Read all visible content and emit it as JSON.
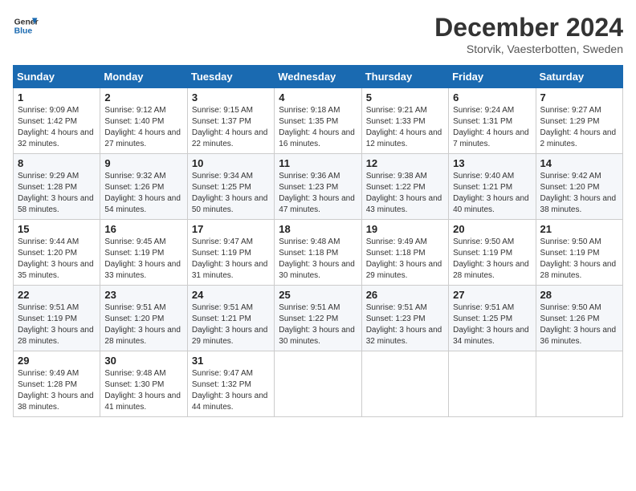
{
  "logo": {
    "line1": "General",
    "line2": "Blue"
  },
  "title": "December 2024",
  "subtitle": "Storvik, Vaesterbotten, Sweden",
  "header": {
    "days": [
      "Sunday",
      "Monday",
      "Tuesday",
      "Wednesday",
      "Thursday",
      "Friday",
      "Saturday"
    ]
  },
  "weeks": [
    [
      {
        "day": "1",
        "info": "Sunrise: 9:09 AM\nSunset: 1:42 PM\nDaylight: 4 hours and 32 minutes."
      },
      {
        "day": "2",
        "info": "Sunrise: 9:12 AM\nSunset: 1:40 PM\nDaylight: 4 hours and 27 minutes."
      },
      {
        "day": "3",
        "info": "Sunrise: 9:15 AM\nSunset: 1:37 PM\nDaylight: 4 hours and 22 minutes."
      },
      {
        "day": "4",
        "info": "Sunrise: 9:18 AM\nSunset: 1:35 PM\nDaylight: 4 hours and 16 minutes."
      },
      {
        "day": "5",
        "info": "Sunrise: 9:21 AM\nSunset: 1:33 PM\nDaylight: 4 hours and 12 minutes."
      },
      {
        "day": "6",
        "info": "Sunrise: 9:24 AM\nSunset: 1:31 PM\nDaylight: 4 hours and 7 minutes."
      },
      {
        "day": "7",
        "info": "Sunrise: 9:27 AM\nSunset: 1:29 PM\nDaylight: 4 hours and 2 minutes."
      }
    ],
    [
      {
        "day": "8",
        "info": "Sunrise: 9:29 AM\nSunset: 1:28 PM\nDaylight: 3 hours and 58 minutes."
      },
      {
        "day": "9",
        "info": "Sunrise: 9:32 AM\nSunset: 1:26 PM\nDaylight: 3 hours and 54 minutes."
      },
      {
        "day": "10",
        "info": "Sunrise: 9:34 AM\nSunset: 1:25 PM\nDaylight: 3 hours and 50 minutes."
      },
      {
        "day": "11",
        "info": "Sunrise: 9:36 AM\nSunset: 1:23 PM\nDaylight: 3 hours and 47 minutes."
      },
      {
        "day": "12",
        "info": "Sunrise: 9:38 AM\nSunset: 1:22 PM\nDaylight: 3 hours and 43 minutes."
      },
      {
        "day": "13",
        "info": "Sunrise: 9:40 AM\nSunset: 1:21 PM\nDaylight: 3 hours and 40 minutes."
      },
      {
        "day": "14",
        "info": "Sunrise: 9:42 AM\nSunset: 1:20 PM\nDaylight: 3 hours and 38 minutes."
      }
    ],
    [
      {
        "day": "15",
        "info": "Sunrise: 9:44 AM\nSunset: 1:20 PM\nDaylight: 3 hours and 35 minutes."
      },
      {
        "day": "16",
        "info": "Sunrise: 9:45 AM\nSunset: 1:19 PM\nDaylight: 3 hours and 33 minutes."
      },
      {
        "day": "17",
        "info": "Sunrise: 9:47 AM\nSunset: 1:19 PM\nDaylight: 3 hours and 31 minutes."
      },
      {
        "day": "18",
        "info": "Sunrise: 9:48 AM\nSunset: 1:18 PM\nDaylight: 3 hours and 30 minutes."
      },
      {
        "day": "19",
        "info": "Sunrise: 9:49 AM\nSunset: 1:18 PM\nDaylight: 3 hours and 29 minutes."
      },
      {
        "day": "20",
        "info": "Sunrise: 9:50 AM\nSunset: 1:19 PM\nDaylight: 3 hours and 28 minutes."
      },
      {
        "day": "21",
        "info": "Sunrise: 9:50 AM\nSunset: 1:19 PM\nDaylight: 3 hours and 28 minutes."
      }
    ],
    [
      {
        "day": "22",
        "info": "Sunrise: 9:51 AM\nSunset: 1:19 PM\nDaylight: 3 hours and 28 minutes."
      },
      {
        "day": "23",
        "info": "Sunrise: 9:51 AM\nSunset: 1:20 PM\nDaylight: 3 hours and 28 minutes."
      },
      {
        "day": "24",
        "info": "Sunrise: 9:51 AM\nSunset: 1:21 PM\nDaylight: 3 hours and 29 minutes."
      },
      {
        "day": "25",
        "info": "Sunrise: 9:51 AM\nSunset: 1:22 PM\nDaylight: 3 hours and 30 minutes."
      },
      {
        "day": "26",
        "info": "Sunrise: 9:51 AM\nSunset: 1:23 PM\nDaylight: 3 hours and 32 minutes."
      },
      {
        "day": "27",
        "info": "Sunrise: 9:51 AM\nSunset: 1:25 PM\nDaylight: 3 hours and 34 minutes."
      },
      {
        "day": "28",
        "info": "Sunrise: 9:50 AM\nSunset: 1:26 PM\nDaylight: 3 hours and 36 minutes."
      }
    ],
    [
      {
        "day": "29",
        "info": "Sunrise: 9:49 AM\nSunset: 1:28 PM\nDaylight: 3 hours and 38 minutes."
      },
      {
        "day": "30",
        "info": "Sunrise: 9:48 AM\nSunset: 1:30 PM\nDaylight: 3 hours and 41 minutes."
      },
      {
        "day": "31",
        "info": "Sunrise: 9:47 AM\nSunset: 1:32 PM\nDaylight: 3 hours and 44 minutes."
      },
      null,
      null,
      null,
      null
    ]
  ]
}
